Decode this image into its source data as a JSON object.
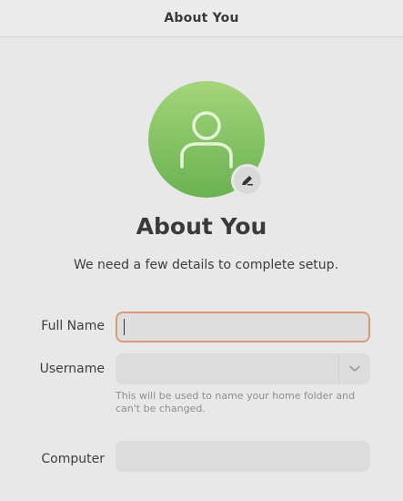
{
  "window": {
    "title": "About You"
  },
  "avatar": {
    "icon": "user-icon",
    "edit_icon": "pencil-icon",
    "gradient_top": "#a4d57a",
    "gradient_bottom": "#69b252"
  },
  "main": {
    "heading": "About You",
    "subheading": "We need a few details to complete setup."
  },
  "form": {
    "full_name": {
      "label": "Full Name",
      "value": "",
      "focused": true
    },
    "username": {
      "label": "Username",
      "value": "",
      "dropdown_icon": "chevron-down-icon",
      "hint": "This will be used to name your home folder and can't be changed."
    },
    "computer": {
      "label": "Computer",
      "value": ""
    }
  },
  "colors": {
    "focus_border": "#d99a7a",
    "field_bg": "#dcdcdc",
    "window_bg": "#e8e8e8",
    "hint_text": "#8e8e8e"
  }
}
